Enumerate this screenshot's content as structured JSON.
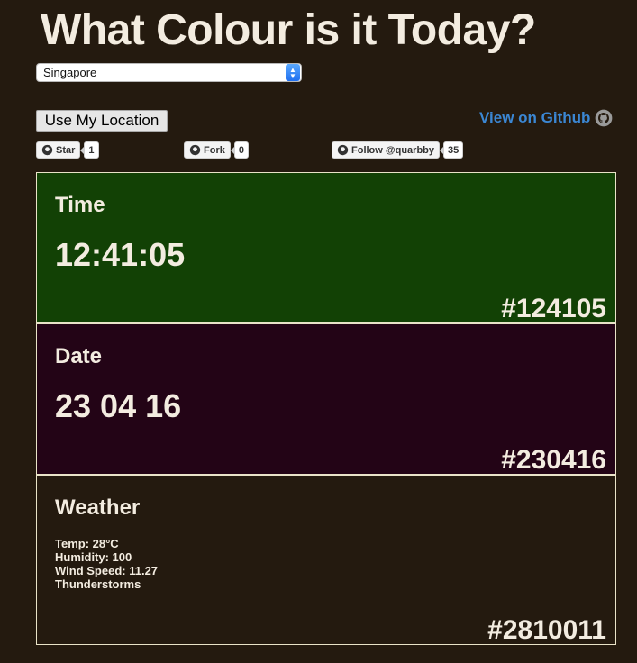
{
  "header": {
    "title": "What Colour is it Today?"
  },
  "location_select": {
    "selected": "Singapore"
  },
  "location_button": {
    "label": "Use My Location"
  },
  "github_link": {
    "label": "View on Github"
  },
  "github_buttons": [
    {
      "label": "Star",
      "count": "1"
    },
    {
      "label": "Fork",
      "count": "0"
    },
    {
      "label": "Follow @quarbby",
      "count": "35"
    }
  ],
  "panels": {
    "time": {
      "label": "Time",
      "value": "12:41:05",
      "hex": "#124105",
      "bg": "#124105"
    },
    "date": {
      "label": "Date",
      "value": "23 04 16",
      "hex": "#230416",
      "bg": "#230416"
    },
    "weather": {
      "label": "Weather",
      "temp": "Temp: 28°C",
      "humidity": "Humidity: 100",
      "wind": "Wind Speed: 11.27",
      "condition": "Thunderstorms",
      "hex": "#2810011",
      "bg": "#241a0f"
    }
  },
  "colors": {
    "page_bg": "#241a0f",
    "link": "#3b87d4",
    "text": "#f3ece0"
  }
}
